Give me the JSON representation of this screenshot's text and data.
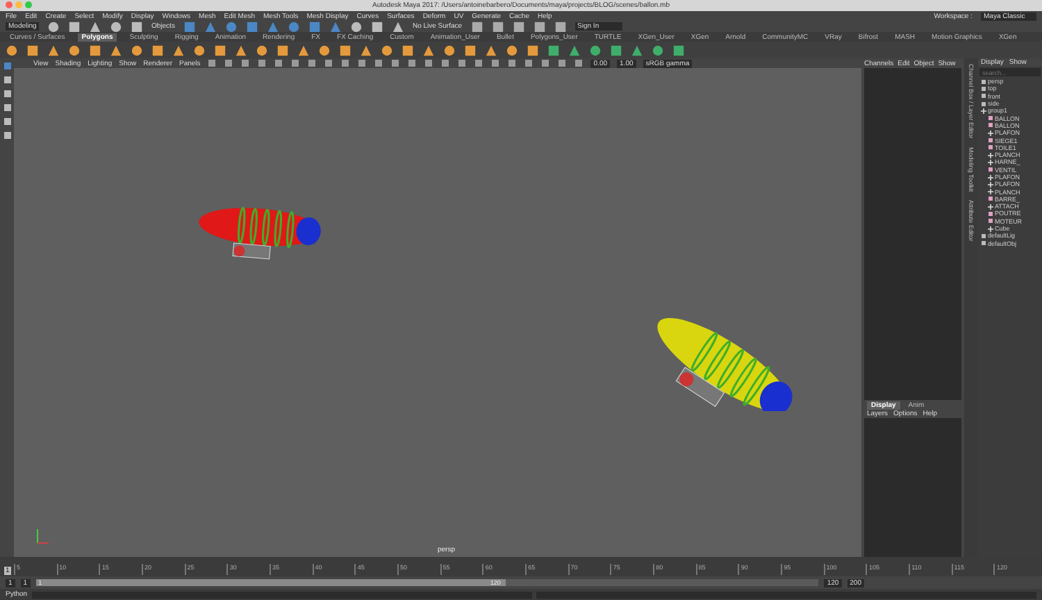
{
  "window": {
    "title": "Autodesk Maya 2017: /Users/antoinebarbero/Documents/maya/projects/BLOG/scenes/ballon.mb"
  },
  "menu_bar": [
    "File",
    "Edit",
    "Create",
    "Select",
    "Modify",
    "Display",
    "Windows",
    "Mesh",
    "Edit Mesh",
    "Mesh Tools",
    "Mesh Display",
    "Curves",
    "Surfaces",
    "Deform",
    "UV",
    "Generate",
    "Cache",
    "Help"
  ],
  "status_line": {
    "mode": "Modeling",
    "selection": "Objects",
    "live_surface": "No Live Surface",
    "sign_in": "Sign In",
    "workspace_label": "Workspace :",
    "workspace": "Maya Classic"
  },
  "shelf_tabs": [
    {
      "label": "Curves / Surfaces",
      "selected": false
    },
    {
      "label": "Polygons",
      "selected": true
    },
    {
      "label": "Sculpting",
      "selected": false
    },
    {
      "label": "Rigging",
      "selected": false
    },
    {
      "label": "Animation",
      "selected": false
    },
    {
      "label": "Rendering",
      "selected": false
    },
    {
      "label": "FX",
      "selected": false
    },
    {
      "label": "FX Caching",
      "selected": false
    },
    {
      "label": "Custom",
      "selected": false
    },
    {
      "label": "Animation_User",
      "selected": false
    },
    {
      "label": "Bullet",
      "selected": false
    },
    {
      "label": "Polygons_User",
      "selected": false
    },
    {
      "label": "TURTLE",
      "selected": false
    },
    {
      "label": "XGen_User",
      "selected": false
    },
    {
      "label": "XGen",
      "selected": false
    },
    {
      "label": "Arnold",
      "selected": false
    },
    {
      "label": "CommunityMC",
      "selected": false
    },
    {
      "label": "VRay",
      "selected": false
    },
    {
      "label": "Bifrost",
      "selected": false
    },
    {
      "label": "MASH",
      "selected": false
    },
    {
      "label": "Motion Graphics",
      "selected": false
    },
    {
      "label": "XGen",
      "selected": false
    }
  ],
  "viewport": {
    "menu": [
      "View",
      "Shading",
      "Lighting",
      "Show",
      "Renderer",
      "Panels"
    ],
    "fields": [
      "0.00",
      "1.00"
    ],
    "color_space": "sRGB gamma",
    "camera": "persp"
  },
  "channel_box": {
    "menu": [
      "Channels",
      "Edit",
      "Object",
      "Show"
    ]
  },
  "side_tabs": [
    "Channel Box / Layer Editor",
    "Modeling Toolkit",
    "Attribute Editor"
  ],
  "layer_editor": {
    "tabs": [
      {
        "label": "Display",
        "selected": true
      },
      {
        "label": "Anim",
        "selected": false
      }
    ],
    "menu": [
      "Layers",
      "Options",
      "Help"
    ]
  },
  "outliner": {
    "menu": [
      "Display",
      "Show"
    ],
    "search_placeholder": "search...",
    "items": [
      {
        "name": "persp",
        "kind": "camera"
      },
      {
        "name": "top",
        "kind": "camera"
      },
      {
        "name": "front",
        "kind": "camera"
      },
      {
        "name": "side",
        "kind": "camera"
      },
      {
        "name": "group1",
        "kind": "group",
        "children": [
          {
            "name": "BALLON",
            "kind": "mesh"
          },
          {
            "name": "BALLON",
            "kind": "mesh"
          },
          {
            "name": "PLAFON",
            "kind": "group"
          },
          {
            "name": "SIEGE1",
            "kind": "mesh"
          },
          {
            "name": "TOILE1",
            "kind": "mesh"
          },
          {
            "name": "PLANCH",
            "kind": "group"
          },
          {
            "name": "HARNE_",
            "kind": "group"
          },
          {
            "name": "VENTIL",
            "kind": "mesh"
          },
          {
            "name": "PLAFON",
            "kind": "group"
          },
          {
            "name": "PLAFON",
            "kind": "group"
          },
          {
            "name": "PLANCH",
            "kind": "group"
          },
          {
            "name": "BARRE_",
            "kind": "mesh"
          },
          {
            "name": "ATTACH",
            "kind": "group"
          },
          {
            "name": "POUTRE",
            "kind": "mesh"
          },
          {
            "name": "MOTEUR",
            "kind": "mesh"
          },
          {
            "name": "Cube",
            "kind": "group"
          }
        ]
      },
      {
        "name": "defaultLig",
        "kind": "set"
      },
      {
        "name": "defaultObj",
        "kind": "set"
      }
    ]
  },
  "timeline": {
    "current": "1",
    "level": 0,
    "ticks": [
      "5",
      "10",
      "15",
      "20",
      "25",
      "30",
      "35",
      "40",
      "45",
      "50",
      "55",
      "60",
      "65",
      "70",
      "75",
      "80",
      "85",
      "90",
      "95",
      "100",
      "105",
      "110",
      "115",
      "120"
    ]
  },
  "range": {
    "level": 0.6,
    "start": "1",
    "playback_start": "1",
    "handle_start": "1",
    "handle_end": "120",
    "playback_end": "120",
    "end": "200"
  },
  "command_line": {
    "label": "Python"
  }
}
